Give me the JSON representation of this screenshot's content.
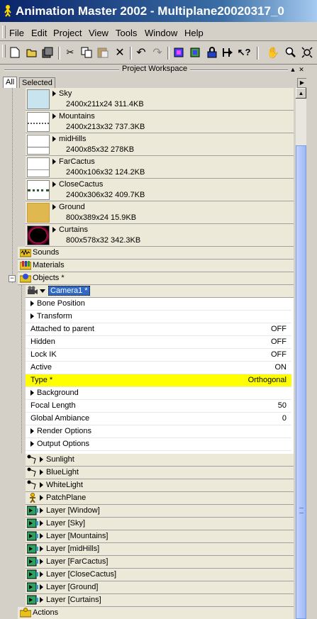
{
  "window": {
    "title": "Animation Master 2002 - Multiplane20020317_0"
  },
  "menu": [
    "File",
    "Edit",
    "Project",
    "View",
    "Tools",
    "Window",
    "Help"
  ],
  "toolbar_icons": [
    "new-icon",
    "open-icon",
    "save-all-icon",
    "cut-icon",
    "copy-icon",
    "paste-icon",
    "delete-icon",
    "undo-icon",
    "redo-icon",
    "render-icon",
    "render-to-file-icon",
    "lock-icon",
    "choreography-icon",
    "help-icon",
    "hand-icon",
    "zoom-icon",
    "fit-icon"
  ],
  "workspace": {
    "caption": "Project Workspace",
    "tabs": [
      "All",
      "Selected"
    ]
  },
  "images": [
    {
      "name": "Sky",
      "info": "2400x211x24 311.4KB",
      "thumb": "#c8e4ee"
    },
    {
      "name": "Mountains",
      "info": "2400x213x32 737.3KB",
      "thumb": "#ffffff"
    },
    {
      "name": "midHills",
      "info": "2400x85x32 278KB",
      "thumb": "#ffffff"
    },
    {
      "name": "FarCactus",
      "info": "2400x106x32 124.2KB",
      "thumb": "#ffffff"
    },
    {
      "name": "CloseCactus",
      "info": "2400x306x32 409.7KB",
      "thumb": "#ffffff"
    },
    {
      "name": "Ground",
      "info": "800x389x24 15.9KB",
      "thumb": "#e0b850"
    },
    {
      "name": "Curtains",
      "info": "800x578x32 342.3KB",
      "thumb": "#000000"
    }
  ],
  "folders": {
    "sounds": "Sounds",
    "materials": "Materials",
    "objects": "Objects *"
  },
  "camera": {
    "name": "Camera1 *"
  },
  "properties": [
    {
      "label": "Bone Position",
      "value": "",
      "expandable": true
    },
    {
      "label": "Transform",
      "value": "",
      "expandable": true
    },
    {
      "label": "Attached to parent",
      "value": "OFF"
    },
    {
      "label": "Hidden",
      "value": "OFF"
    },
    {
      "label": "Lock IK",
      "value": "OFF"
    },
    {
      "label": "Active",
      "value": "ON"
    },
    {
      "label": "Type *",
      "value": "Orthogonal",
      "highlight": true
    },
    {
      "label": "Background",
      "value": "",
      "expandable": true
    },
    {
      "label": "Focal Length",
      "value": "50"
    },
    {
      "label": "Global Ambiance",
      "value": "0"
    },
    {
      "label": "Render Options",
      "value": "",
      "expandable": true
    },
    {
      "label": "Output Options",
      "value": "",
      "expandable": true
    }
  ],
  "objects": [
    {
      "name": "Sunlight",
      "kind": "light-icon"
    },
    {
      "name": "BlueLight",
      "kind": "light-icon"
    },
    {
      "name": "WhiteLight",
      "kind": "light-icon"
    },
    {
      "name": "PatchPlane",
      "kind": "model-icon"
    },
    {
      "name": "Layer [Window]",
      "kind": "layer-icon"
    },
    {
      "name": "Layer [Sky]",
      "kind": "layer-icon"
    },
    {
      "name": "Layer [Mountains]",
      "kind": "layer-icon"
    },
    {
      "name": "Layer [midHills]",
      "kind": "layer-icon"
    },
    {
      "name": "Layer [FarCactus]",
      "kind": "layer-icon"
    },
    {
      "name": "Layer [CloseCactus]",
      "kind": "layer-icon"
    },
    {
      "name": "Layer [Ground]",
      "kind": "layer-icon"
    },
    {
      "name": "Layer [Curtains]",
      "kind": "layer-icon"
    }
  ],
  "actions": "Actions"
}
